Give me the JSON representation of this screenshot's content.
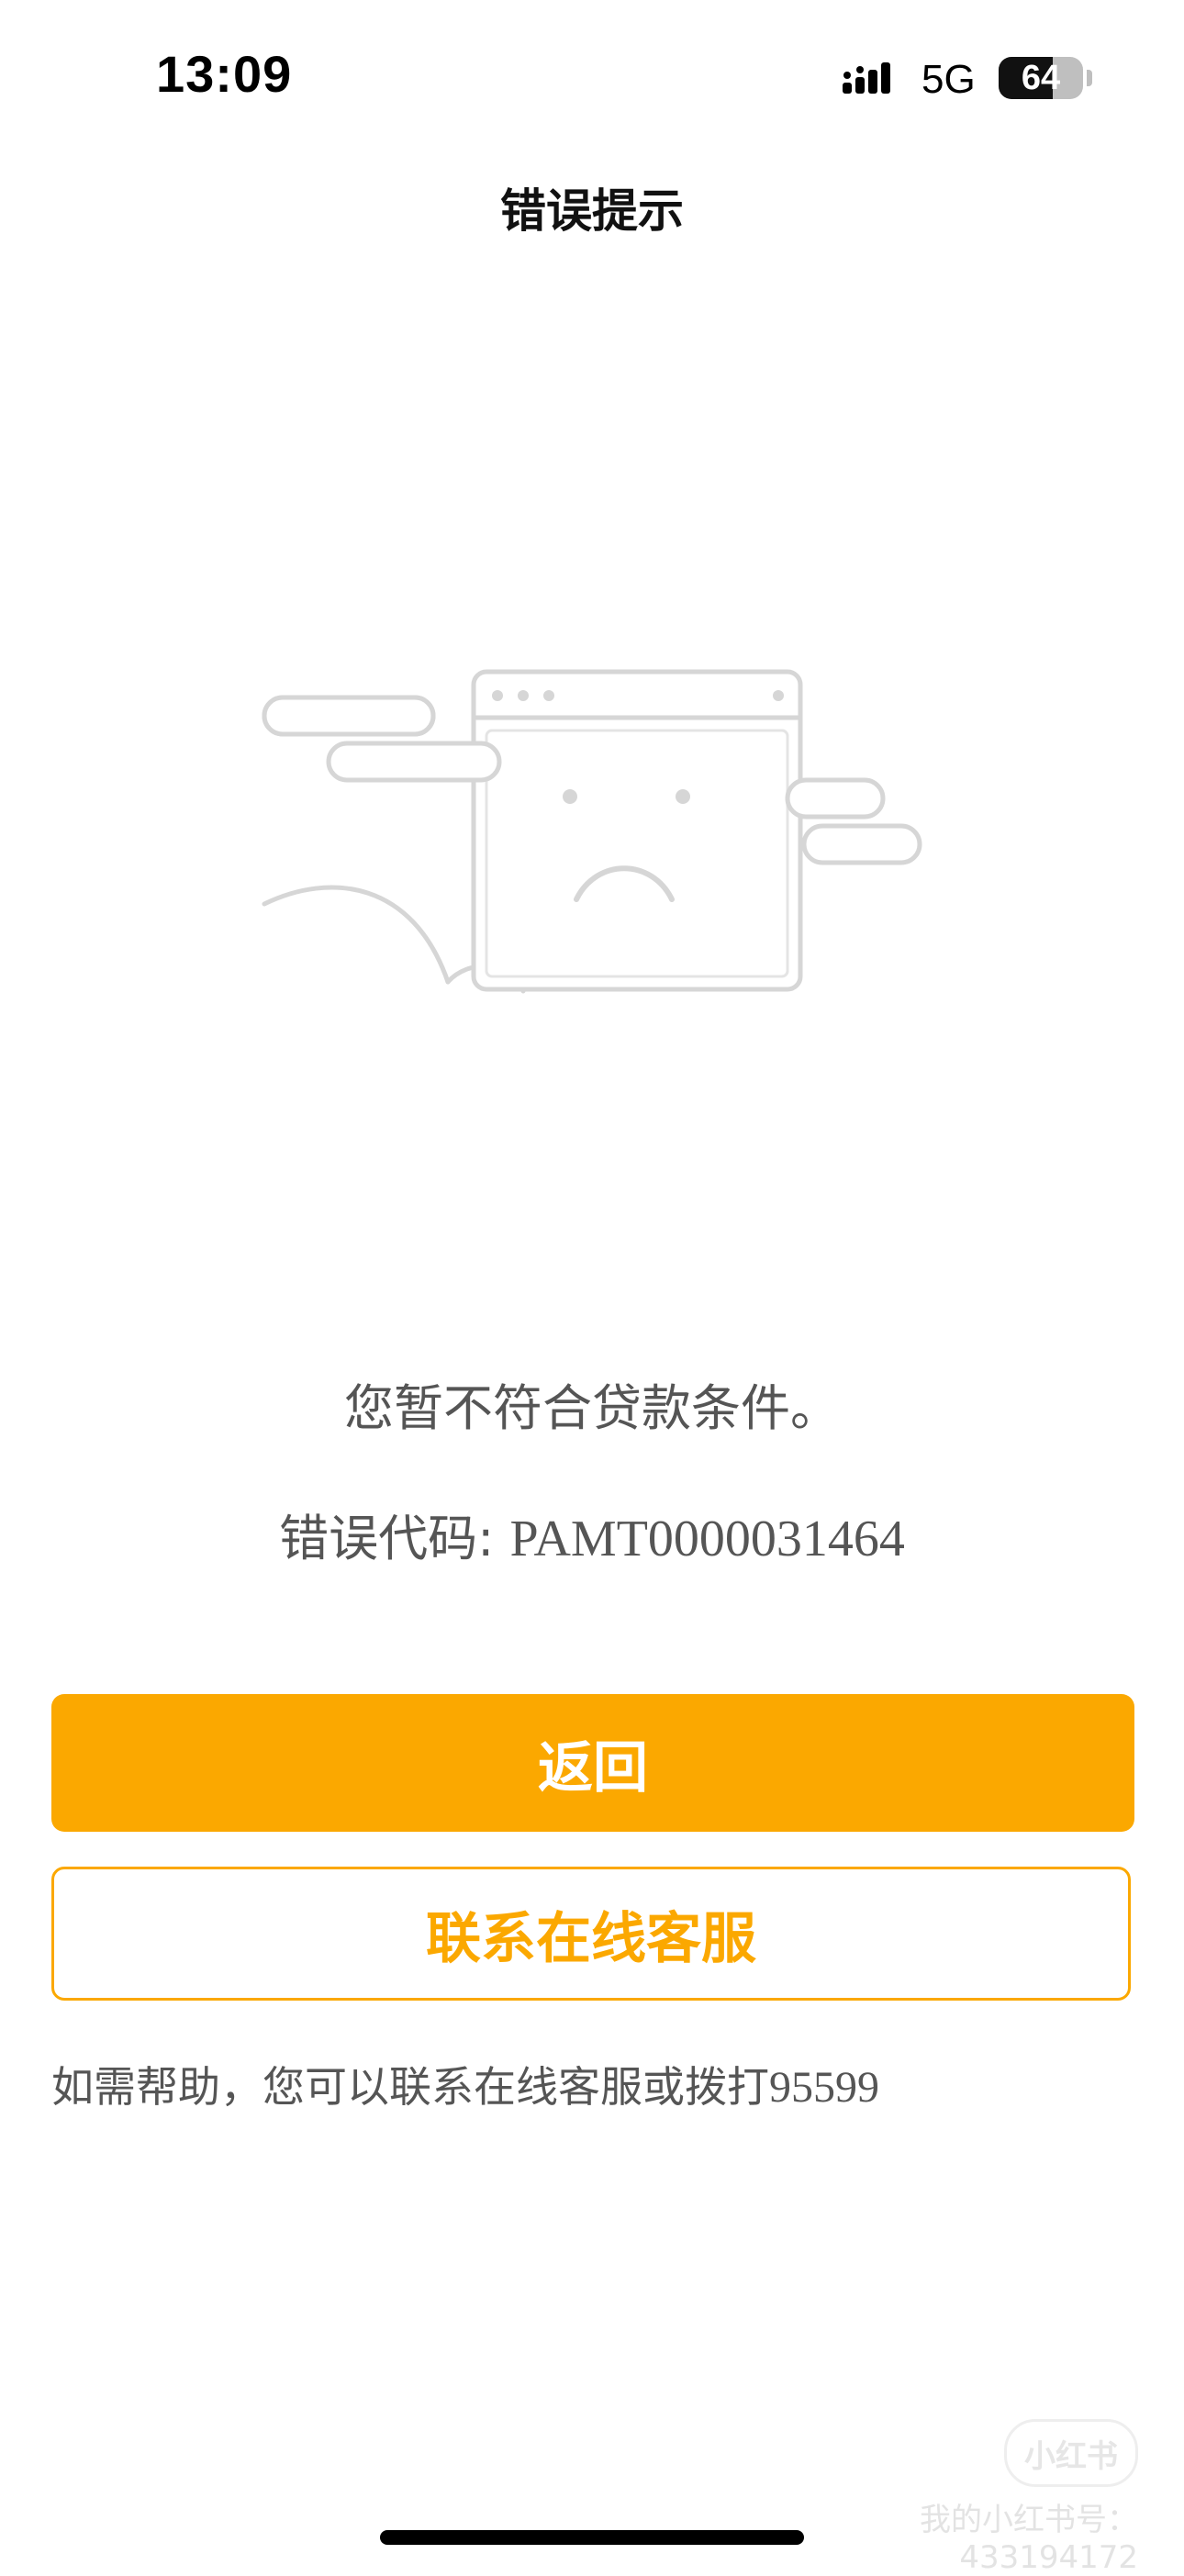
{
  "status_bar": {
    "time": "13:09",
    "network": "5G",
    "battery": "64",
    "battery_level": 0.64
  },
  "header": {
    "title": "错误提示"
  },
  "illustration": {
    "icon": "sad-browser-window-icon"
  },
  "message": {
    "text": "您暂不符合贷款条件。",
    "code_label": "错误代码: ",
    "code_value": "PAMT0000031464"
  },
  "actions": {
    "back_label": "返回",
    "service_label": "联系在线客服"
  },
  "help": {
    "text": "如需帮助，您可以联系在线客服或拨打",
    "phone": "95599"
  },
  "watermark": {
    "logo": "小红书",
    "text": "我的小红书号：433194172"
  },
  "colors": {
    "accent": "#fba800",
    "text_secondary": "#555555",
    "illustration_stroke": "#d6d6d6"
  }
}
